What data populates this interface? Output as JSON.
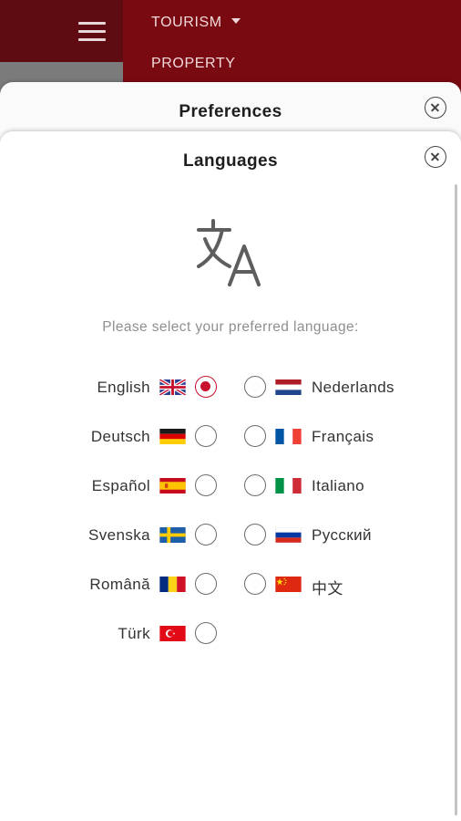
{
  "topbar": {
    "nav_tourism": "TOURISM",
    "nav_property": "PROPERTY",
    "background": "#7a0a12"
  },
  "preferences": {
    "title": "Preferences"
  },
  "languages": {
    "title": "Languages",
    "prompt": "Please select your preferred language:",
    "selected": "English",
    "accent": "#c8102e",
    "left_column": [
      {
        "label": "English",
        "flag": "uk-flag",
        "checked": true
      },
      {
        "label": "Deutsch",
        "flag": "germany-flag",
        "checked": false
      },
      {
        "label": "Español",
        "flag": "spain-flag",
        "checked": false
      },
      {
        "label": "Svenska",
        "flag": "sweden-flag",
        "checked": false
      },
      {
        "label": "Română",
        "flag": "romania-flag",
        "checked": false
      },
      {
        "label": "Türk",
        "flag": "turkey-flag",
        "checked": false
      }
    ],
    "right_column": [
      {
        "label": "Nederlands",
        "flag": "netherlands-flag",
        "checked": false
      },
      {
        "label": "Français",
        "flag": "france-flag",
        "checked": false
      },
      {
        "label": "Italiano",
        "flag": "italy-flag",
        "checked": false
      },
      {
        "label": "Русский",
        "flag": "russia-flag",
        "checked": false
      },
      {
        "label": "中文",
        "flag": "china-flag",
        "checked": false
      }
    ]
  }
}
